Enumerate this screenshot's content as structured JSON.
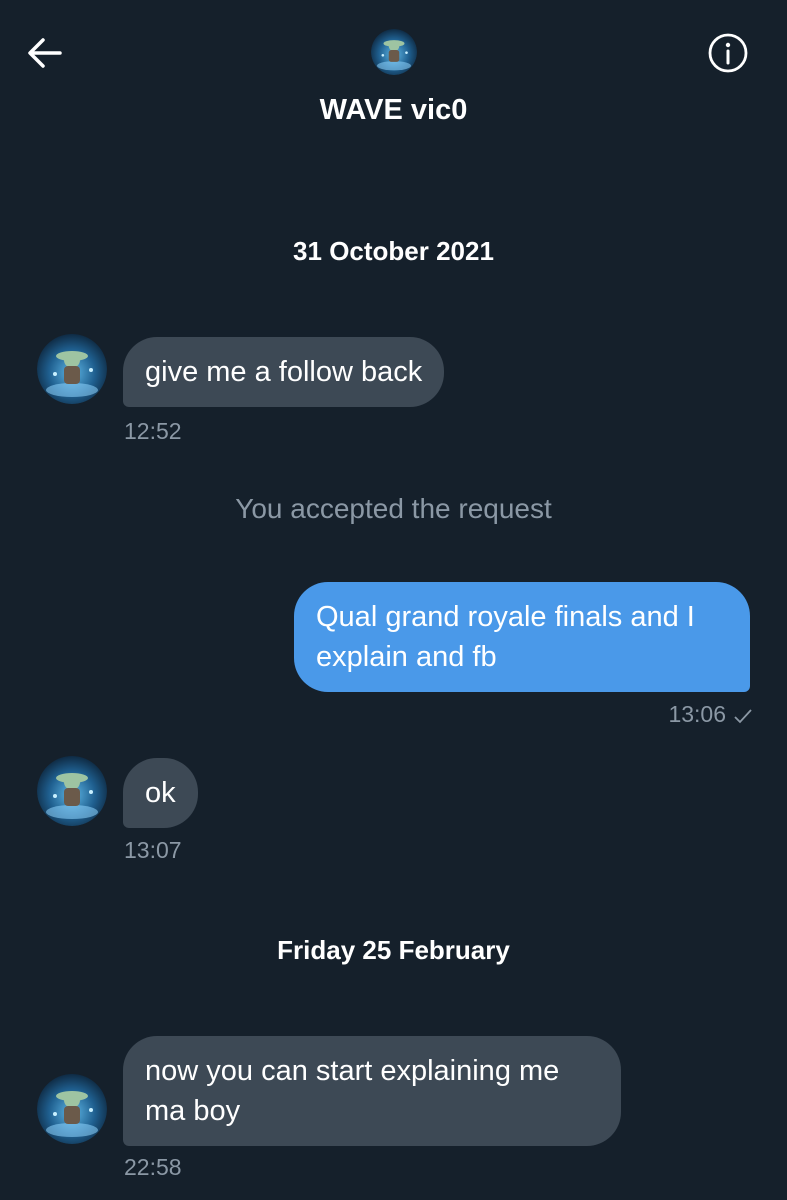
{
  "header": {
    "title": "WAVE vic0",
    "back_icon": "arrow-left-icon",
    "info_icon": "info-circle-icon"
  },
  "conversation": {
    "sections": [
      {
        "date": "31 October 2021",
        "messages": [
          {
            "direction": "incoming",
            "text": "give me a follow back",
            "time": "12:52"
          },
          {
            "system": "You accepted the request"
          },
          {
            "direction": "outgoing",
            "lines": [
              "Qual grand royale finals and I",
              "explain and fb"
            ],
            "time": "13:06",
            "status_icon": "checkmark-icon"
          },
          {
            "direction": "incoming",
            "text": "ok",
            "time": "13:07"
          }
        ]
      },
      {
        "date": "Friday 25 February",
        "messages": [
          {
            "direction": "incoming",
            "lines": [
              "now you can start explaining me",
              "ma boy"
            ],
            "time": "22:58"
          }
        ]
      }
    ]
  },
  "colors": {
    "background": "#15202b",
    "incoming_bubble": "#3d4955",
    "outgoing_bubble": "#4a99e9",
    "muted_text": "#8b98a5"
  }
}
